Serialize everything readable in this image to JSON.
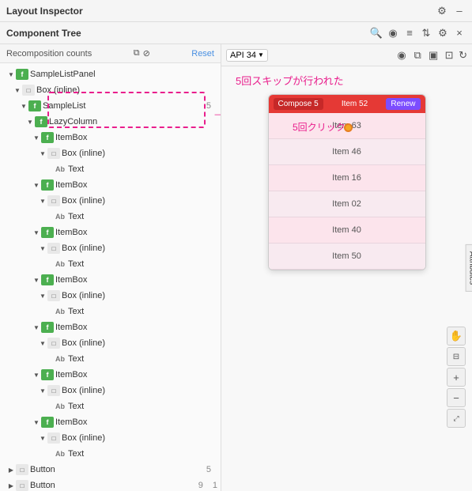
{
  "titlebar": {
    "title": "Layout Inspector",
    "gear_icon": "⚙",
    "minus_icon": "–"
  },
  "toolbar": {
    "label": "Component Tree",
    "search_icon": "🔍",
    "eye_icon": "👁",
    "list_icon": "☰",
    "filter_icon": "⇅",
    "gear_icon": "⚙",
    "close_icon": "×"
  },
  "recomp": {
    "label": "Recomposition counts",
    "reset": "Reset"
  },
  "tree": {
    "items": [
      {
        "indent": 4,
        "arrow": "▼",
        "icon_type": "f",
        "label": "SampleListPanel",
        "count": ""
      },
      {
        "indent": 12,
        "arrow": "▼",
        "icon_type": "box",
        "label": "Box (inline)",
        "count": ""
      },
      {
        "indent": 20,
        "arrow": "▼",
        "icon_type": "f",
        "label": "SampleList",
        "count": "5"
      },
      {
        "indent": 28,
        "arrow": "▼",
        "icon_type": "f",
        "label": "LazyColumn",
        "count": ""
      },
      {
        "indent": 36,
        "arrow": "▼",
        "icon_type": "f",
        "label": "ItemBox",
        "count": ""
      },
      {
        "indent": 44,
        "arrow": "▼",
        "icon_type": "box",
        "label": "Box (inline)",
        "count": ""
      },
      {
        "indent": 52,
        "arrow": "",
        "icon_type": "ab",
        "label": "Text",
        "count": ""
      },
      {
        "indent": 36,
        "arrow": "▼",
        "icon_type": "f",
        "label": "ItemBox",
        "count": ""
      },
      {
        "indent": 44,
        "arrow": "▼",
        "icon_type": "box",
        "label": "Box (inline)",
        "count": ""
      },
      {
        "indent": 52,
        "arrow": "",
        "icon_type": "ab",
        "label": "Text",
        "count": ""
      },
      {
        "indent": 36,
        "arrow": "▼",
        "icon_type": "f",
        "label": "ItemBox",
        "count": ""
      },
      {
        "indent": 44,
        "arrow": "▼",
        "icon_type": "box",
        "label": "Box (inline)",
        "count": ""
      },
      {
        "indent": 52,
        "arrow": "",
        "icon_type": "ab",
        "label": "Text",
        "count": ""
      },
      {
        "indent": 36,
        "arrow": "▼",
        "icon_type": "f",
        "label": "ItemBox",
        "count": ""
      },
      {
        "indent": 44,
        "arrow": "▼",
        "icon_type": "box",
        "label": "Box (inline)",
        "count": ""
      },
      {
        "indent": 52,
        "arrow": "",
        "icon_type": "ab",
        "label": "Text",
        "count": ""
      },
      {
        "indent": 36,
        "arrow": "▼",
        "icon_type": "f",
        "label": "ItemBox",
        "count": ""
      },
      {
        "indent": 44,
        "arrow": "▼",
        "icon_type": "box",
        "label": "Box (inline)",
        "count": ""
      },
      {
        "indent": 52,
        "arrow": "",
        "icon_type": "ab",
        "label": "Text",
        "count": ""
      },
      {
        "indent": 36,
        "arrow": "▼",
        "icon_type": "f",
        "label": "ItemBox",
        "count": ""
      },
      {
        "indent": 44,
        "arrow": "▼",
        "icon_type": "box",
        "label": "Box (inline)",
        "count": ""
      },
      {
        "indent": 52,
        "arrow": "",
        "icon_type": "ab",
        "label": "Text",
        "count": ""
      },
      {
        "indent": 36,
        "arrow": "▼",
        "icon_type": "f",
        "label": "ItemBox",
        "count": ""
      },
      {
        "indent": 44,
        "arrow": "▼",
        "icon_type": "box",
        "label": "Box (inline)",
        "count": ""
      },
      {
        "indent": 52,
        "arrow": "",
        "icon_type": "ab",
        "label": "Text",
        "count": ""
      }
    ],
    "bottom_items": [
      {
        "indent": 4,
        "arrow": "▶",
        "icon_type": "box",
        "label": "Button",
        "count": "5"
      },
      {
        "indent": 4,
        "arrow": "▶",
        "icon_type": "box",
        "label": "Button",
        "count": "9"
      }
    ]
  },
  "api": {
    "label": "API 34",
    "chevron": "▼"
  },
  "preview": {
    "skip_annotation": "5回スキップが行われた",
    "click_annotation": "5回クリック",
    "compose_btn": "Compose 5",
    "item_header": "Item 52",
    "renew_btn": "Renew",
    "items": [
      "Item 63",
      "Item 46",
      "Item 16",
      "Item 02",
      "Item 40",
      "Item 50"
    ]
  },
  "attributes": {
    "tab_label": "Attributes"
  }
}
